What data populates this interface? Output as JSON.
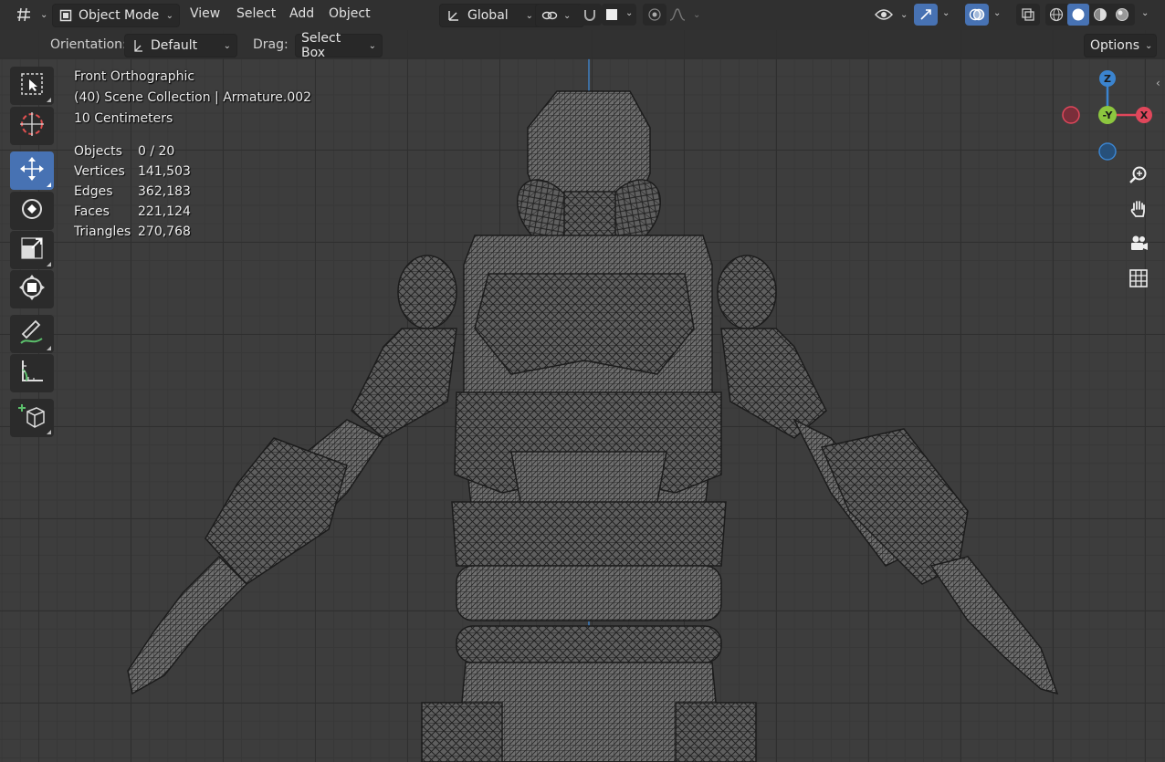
{
  "header": {
    "editor_type_icon": "grid-hash-icon",
    "mode": "Object Mode",
    "menus": [
      "View",
      "Select",
      "Add",
      "Object"
    ],
    "transform_orientation": "Global",
    "pivot_icon": "link-icon"
  },
  "tool_header": {
    "orientation_label": "Orientation:",
    "orientation_value": "Default",
    "drag_label": "Drag:",
    "drag_value": "Select Box",
    "options_label": "Options"
  },
  "viewport_info": {
    "view_name": "Front Orthographic",
    "collection": "(40) Scene Collection | Armature.002",
    "scale": "10 Centimeters"
  },
  "stats": [
    {
      "label": "Objects",
      "value": "0 / 20"
    },
    {
      "label": "Vertices",
      "value": "141,503"
    },
    {
      "label": "Edges",
      "value": "362,183"
    },
    {
      "label": "Faces",
      "value": "221,124"
    },
    {
      "label": "Triangles",
      "value": "270,768"
    }
  ],
  "gizmo": {
    "z_label": "Z",
    "y_label": "-Y",
    "x_label": "X"
  },
  "tools": [
    "select-box-icon",
    "cursor-icon",
    "move-icon",
    "rotate-icon",
    "scale-icon",
    "transform-icon",
    "annotate-icon",
    "measure-icon",
    "add-cube-icon"
  ],
  "colors": {
    "accent": "#4772b3",
    "x_axis": "#e0475b",
    "y_axis": "#8cc63f",
    "z_axis": "#3b84cf"
  }
}
